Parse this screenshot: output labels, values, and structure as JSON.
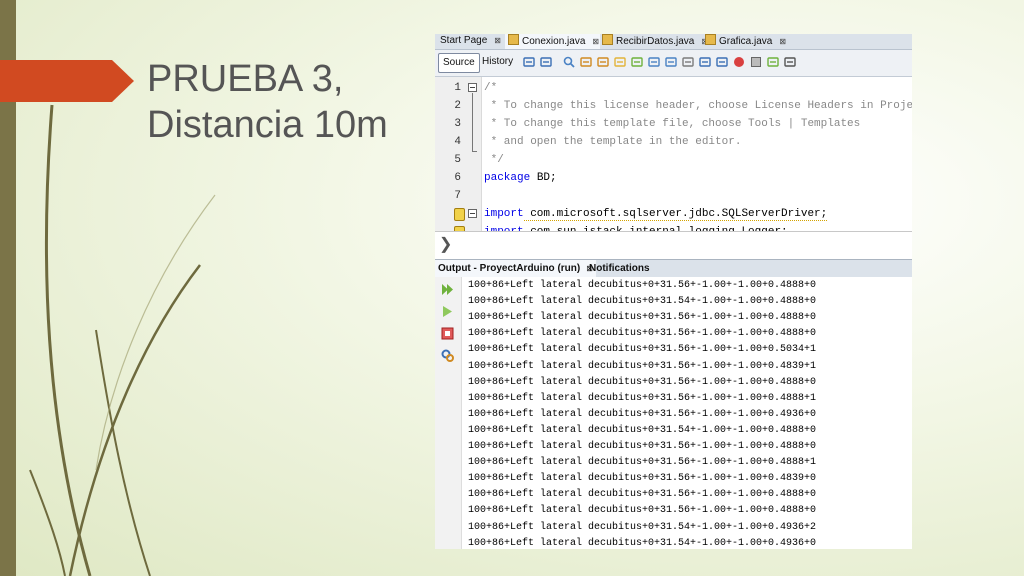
{
  "slide": {
    "title_line1": "PRUEBA 3,",
    "title_line2": "Distancia 10m"
  },
  "ide": {
    "doc_tabs": [
      {
        "label": "Start Page"
      },
      {
        "label": "Conexion.java"
      },
      {
        "label": "RecibirDatos.java"
      },
      {
        "label": "Grafica.java"
      }
    ],
    "tab_close_glyph": "⊠",
    "views": {
      "source": "Source",
      "history": "History"
    },
    "toolbar_icons": [
      "back-icon",
      "forward-icon",
      "find-icon",
      "find-prev-icon",
      "find-next-icon",
      "toggle-highlight-icon",
      "toggle-rect-icon",
      "prev-bookmark-icon",
      "next-bookmark-icon",
      "toggle-bookmark-icon",
      "shift-left-icon",
      "shift-right-icon",
      "start-macro-icon",
      "stop-macro-icon",
      "comment-icon",
      "uncomment-icon"
    ],
    "editor": {
      "lines": [
        {
          "n": "1",
          "text": "/*",
          "cls": "cmt"
        },
        {
          "n": "2",
          "text": " * To change this license header, choose License Headers in Project Properties.",
          "cls": "cmt"
        },
        {
          "n": "3",
          "text": " * To change this template file, choose Tools | Templates",
          "cls": "cmt"
        },
        {
          "n": "4",
          "text": " * and open the template in the editor.",
          "cls": "cmt"
        },
        {
          "n": "5",
          "text": " */",
          "cls": "cmt"
        },
        {
          "n": "6",
          "kw": "package",
          "rest": " BD;"
        },
        {
          "n": "7",
          "text": "",
          "cls": "normal"
        },
        {
          "n": "8",
          "kw": "import",
          "rest": " com.microsoft.sqlserver.jdbc.SQLServerDriver;"
        },
        {
          "n": "9",
          "kw": "import",
          "rest": " com.sun.istack.internal.logging.Logger;"
        }
      ]
    },
    "output": {
      "tabs": [
        {
          "label": "Output - ProyectArduino (run)"
        },
        {
          "label": "Notifications"
        }
      ],
      "lines": [
        "100+86+Left lateral decubitus+0+31.56+-1.00+-1.00+0.4888+0",
        "100+86+Left lateral decubitus+0+31.54+-1.00+-1.00+0.4888+0",
        "100+86+Left lateral decubitus+0+31.56+-1.00+-1.00+0.4888+0",
        "100+86+Left lateral decubitus+0+31.56+-1.00+-1.00+0.4888+0",
        "100+86+Left lateral decubitus+0+31.56+-1.00+-1.00+0.5034+1",
        "100+86+Left lateral decubitus+0+31.56+-1.00+-1.00+0.4839+1",
        "100+86+Left lateral decubitus+0+31.56+-1.00+-1.00+0.4888+0",
        "100+86+Left lateral decubitus+0+31.56+-1.00+-1.00+0.4888+1",
        "100+86+Left lateral decubitus+0+31.56+-1.00+-1.00+0.4936+0",
        "100+86+Left lateral decubitus+0+31.54+-1.00+-1.00+0.4888+0",
        "100+86+Left lateral decubitus+0+31.56+-1.00+-1.00+0.4888+0",
        "100+86+Left lateral decubitus+0+31.56+-1.00+-1.00+0.4888+1",
        "100+86+Left lateral decubitus+0+31.56+-1.00+-1.00+0.4839+0",
        "100+86+Left lateral decubitus+0+31.56+-1.00+-1.00+0.4888+0",
        "100+86+Left lateral decubitus+0+31.56+-1.00+-1.00+0.4888+0",
        "100+86+Left lateral decubitus+0+31.54+-1.00+-1.00+0.4936+2",
        "100+86+Left lateral decubitus+0+31.54+-1.00+-1.00+0.4936+0"
      ]
    }
  },
  "colors": {
    "accent": "#d14a21",
    "side_bar": "#7b7448",
    "stem": "#6e6a3e",
    "title_text": "#555555"
  }
}
